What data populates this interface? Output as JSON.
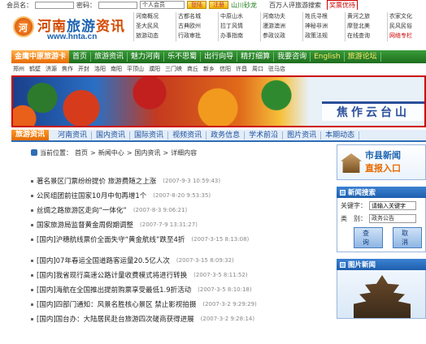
{
  "login": {
    "member_label": "会员名：",
    "password_label": "密码：",
    "member_type": "个人会员",
    "login_button": "登陆",
    "register_button": "注册",
    "mountain_link": "山川砂龙",
    "tour_link": "百万人评旅游搜索",
    "promo_link": "奖票优待"
  },
  "logo": {
    "title_part1": "河南",
    "title_part2": "旅游",
    "title_part3": "资讯",
    "url": "www.hnta.cn"
  },
  "quick_links": [
    {
      "label": "河南概况",
      "red": false
    },
    {
      "label": "古都名城",
      "red": false
    },
    {
      "label": "中原山水",
      "red": false
    },
    {
      "label": "河南功夫",
      "red": false
    },
    {
      "label": "姓氏寻根",
      "red": false
    },
    {
      "label": "黄河之旅",
      "red": false
    },
    {
      "label": "农家文化",
      "red": false
    },
    {
      "label": "圣大民风",
      "red": false
    },
    {
      "label": "古典欧州",
      "red": false
    },
    {
      "label": "拉丁风情",
      "red": false
    },
    {
      "label": "漫游澳洲",
      "red": false
    },
    {
      "label": "神秘非洲",
      "red": false
    },
    {
      "label": "摩登北美",
      "red": false
    },
    {
      "label": "民风民俗",
      "red": false
    },
    {
      "label": "旅游动态",
      "red": false
    },
    {
      "label": "行政审批",
      "red": false
    },
    {
      "label": "办事指南",
      "red": false
    },
    {
      "label": "参政议政",
      "red": false
    },
    {
      "label": "政策法规",
      "red": false
    },
    {
      "label": "在线查询",
      "red": false
    },
    {
      "label": "网络专栏",
      "red": true
    }
  ],
  "main_nav": {
    "card": "金鹰中原旅游卡",
    "items": [
      {
        "label": "首页",
        "en": false
      },
      {
        "label": "旅游资讯",
        "en": false
      },
      {
        "label": "魅力河南",
        "en": false
      },
      {
        "label": "乐不思蜀",
        "en": false
      },
      {
        "label": "出行向导",
        "en": false
      },
      {
        "label": "精打细算",
        "en": false
      },
      {
        "label": "我要咨询",
        "en": false
      },
      {
        "label": "English",
        "en": true
      },
      {
        "label": "旅游论坛",
        "en": true
      }
    ]
  },
  "cities": [
    "郑州",
    "鹤壁",
    "济源",
    "焦作",
    "开封",
    "洛阳",
    "南阳",
    "平顶山",
    "濮阳",
    "三门峡",
    "商丘",
    "新乡",
    "信阳",
    "许昌",
    "周口",
    "驻马店"
  ],
  "banner": {
    "caption": "焦作云台山"
  },
  "sub_nav": {
    "brand": "旅游资讯",
    "items": [
      "河南资讯",
      "国内资讯",
      "国际资讯",
      "视频资讯",
      "政务信息",
      "学术前沿",
      "图片资讯",
      "本期动态"
    ]
  },
  "breadcrumb": {
    "prefix": "当前位置：",
    "path": [
      "首页",
      "新闻中心",
      "国内资讯",
      "详细内容"
    ]
  },
  "news_group1": [
    {
      "title": "著名景区门票纷纷提价  旅游费随之上涨",
      "date": "(2007-9-3 10:59:43)"
    },
    {
      "title": "公民组团前往国家10月中旬再增1个",
      "date": "(2007-8-20 9:53:35)"
    },
    {
      "title": "丝绸之路旅游区走向“一体化”",
      "date": "(2007-8-3 9:06:21)"
    },
    {
      "title": "国家旅游局监督黄金周假期调整",
      "date": "(2007-7-9 13:31:27)"
    },
    {
      "title": "[国内]沪穗航线票价全面失守“黄金航线”跌至4折",
      "date": "(2007-3-15 8:13:08)"
    }
  ],
  "news_group2": [
    {
      "title": "[国内]07年春运全国道路客运量20.5亿人次",
      "date": "(2007-3-15 8:09:32)"
    },
    {
      "title": "[国内]我省现行高速公路计量收费模式将进行转换",
      "date": "(2007-3-5 8:11:52)"
    },
    {
      "title": "[国内]海航在全国推出提前购票享受最低1.9折活动",
      "date": "(2007-3-5 8:10:18)"
    },
    {
      "title": "[国内]四部门通知：风景名胜核心景区  禁止影视拍摄",
      "date": "(2007-3-2 9:29:29)"
    },
    {
      "title": "[国内]国台办：大陆居民赴台旅游四次磋商获得进展",
      "date": "(2007-3-2 9:28:14)"
    }
  ],
  "promo": {
    "line1": "市县新闻",
    "line2": "直报入口"
  },
  "search": {
    "header": "新闻搜索",
    "keyword_label": "关键字：",
    "keyword_placeholder": "请输入关键字",
    "category_label": "类　别：",
    "category_value": "政务公告",
    "confirm_button": "查 询",
    "cancel_button": "取 消"
  },
  "photo": {
    "header": "图片新闻"
  }
}
